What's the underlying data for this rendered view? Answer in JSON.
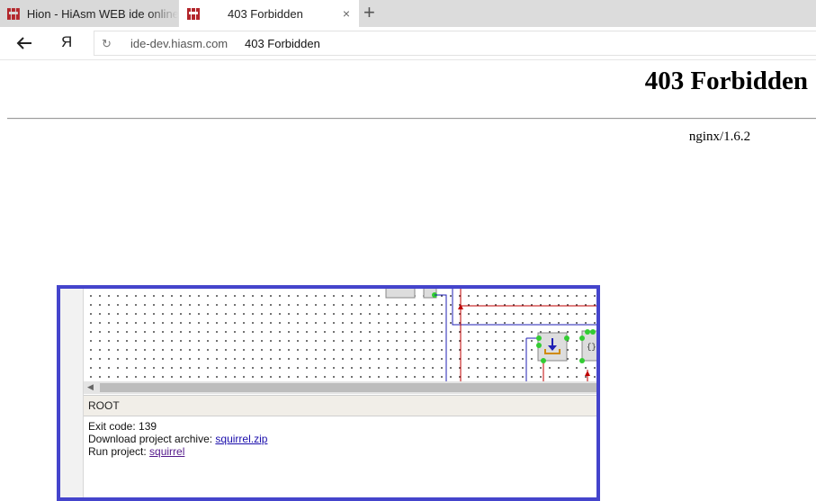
{
  "tabs": [
    {
      "label": "Hion - HiAsm WEB ide online",
      "active": false
    },
    {
      "label": "403 Forbidden",
      "active": true
    }
  ],
  "tab_icons": {
    "favicon": "hiasm-logo-icon",
    "close": "×",
    "new_tab": "+"
  },
  "navbar": {
    "back_icon": "←",
    "yandex_icon": "Я",
    "reload_icon": "↻",
    "url_domain": "ide-dev.hiasm.com",
    "url_title": "403 Forbidden"
  },
  "page": {
    "heading": "403 Forbidden",
    "server": "nginx/1.6.2"
  },
  "ide": {
    "panel_title": "ROOT",
    "exit_code": "Exit code: 139",
    "download_label": "Download project archive: ",
    "download_link": "squirrel.zip",
    "run_label": "Run project: ",
    "run_link": "squirrel"
  },
  "colors": {
    "frame_border": "#4444cc",
    "wire_blue": "#1f1fb4",
    "wire_red": "#c00000",
    "pin_green": "#33cc33",
    "element_box": "#dddddd"
  }
}
